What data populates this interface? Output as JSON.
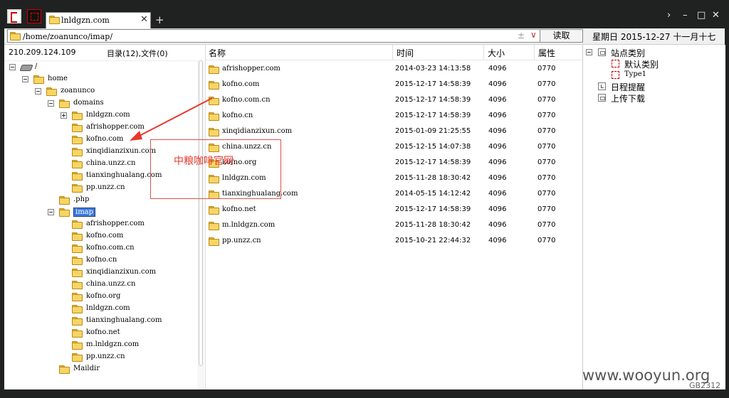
{
  "titlebar": {
    "tab_title": "lnldgzn.com",
    "tab_close": "✕",
    "tab_add": "+",
    "icons": [
      "app-logo-icon",
      "screen-record-icon",
      "folder-icon"
    ],
    "window_controls": [
      "›",
      "–",
      "□",
      "✕"
    ]
  },
  "address_bar": {
    "path": "/home/zoanunco/imap/",
    "plus": "±",
    "dropdown": "∨",
    "read_button": "读取",
    "date": "星期日  2015-12-27  十一月十七"
  },
  "left_pane": {
    "server_ip": "210.209.124.109",
    "summary": "目录(12),文件(0)",
    "tree": [
      {
        "label": "/",
        "icon": "drive-icon"
      },
      {
        "label": "home",
        "icon": "folder-icon"
      },
      {
        "label": "zoanunco",
        "icon": "folder-icon"
      },
      {
        "label": "domains",
        "icon": "folder-icon"
      },
      {
        "label": "lnldgzn.com",
        "icon": "folder-icon"
      },
      {
        "label": "afrishopper.com",
        "icon": "folder-icon"
      },
      {
        "label": "kofno.com",
        "icon": "folder-icon"
      },
      {
        "label": "xinqidianzixun.com",
        "icon": "folder-icon"
      },
      {
        "label": "china.unzz.cn",
        "icon": "folder-icon"
      },
      {
        "label": "tianxinghualang.com",
        "icon": "folder-icon"
      },
      {
        "label": "pp.unzz.cn",
        "icon": "folder-icon"
      },
      {
        "label": ".php",
        "icon": "folder-icon"
      },
      {
        "label": "imap",
        "icon": "folder-icon",
        "selected": true
      },
      {
        "label": "afrishopper.com",
        "icon": "folder-icon"
      },
      {
        "label": "kofno.com",
        "icon": "folder-icon"
      },
      {
        "label": "kofno.com.cn",
        "icon": "folder-icon"
      },
      {
        "label": "kofno.cn",
        "icon": "folder-icon"
      },
      {
        "label": "xinqidianzixun.com",
        "icon": "folder-icon"
      },
      {
        "label": "china.unzz.cn",
        "icon": "folder-icon"
      },
      {
        "label": "kofno.org",
        "icon": "folder-icon"
      },
      {
        "label": "lnldgzn.com",
        "icon": "folder-icon"
      },
      {
        "label": "tianxinghualang.com",
        "icon": "folder-icon"
      },
      {
        "label": "kofno.net",
        "icon": "folder-icon"
      },
      {
        "label": "m.lnldgzn.com",
        "icon": "folder-icon"
      },
      {
        "label": "pp.unzz.cn",
        "icon": "folder-icon"
      },
      {
        "label": "Maildir",
        "icon": "folder-icon"
      }
    ]
  },
  "file_list": {
    "columns": [
      "名称",
      "时间",
      "大小",
      "属性"
    ],
    "rows": [
      {
        "name": "afrishopper.com",
        "time": "2014-03-23 14:13:58",
        "size": "4096",
        "attr": "0770"
      },
      {
        "name": "kofno.com",
        "time": "2015-12-17 14:58:39",
        "size": "4096",
        "attr": "0770"
      },
      {
        "name": "kofno.com.cn",
        "time": "2015-12-17 14:58:39",
        "size": "4096",
        "attr": "0770"
      },
      {
        "name": "kofno.cn",
        "time": "2015-12-17 14:58:39",
        "size": "4096",
        "attr": "0770"
      },
      {
        "name": "xinqidianzixun.com",
        "time": "2015-01-09 21:25:55",
        "size": "4096",
        "attr": "0770"
      },
      {
        "name": "china.unzz.cn",
        "time": "2015-12-15 14:07:38",
        "size": "4096",
        "attr": "0770"
      },
      {
        "name": "kofno.org",
        "time": "2015-12-17 14:58:39",
        "size": "4096",
        "attr": "0770"
      },
      {
        "name": "lnldgzn.com",
        "time": "2015-11-28 18:30:42",
        "size": "4096",
        "attr": "0770"
      },
      {
        "name": "tianxinghualang.com",
        "time": "2014-05-15 14:12:42",
        "size": "4096",
        "attr": "0770"
      },
      {
        "name": "kofno.net",
        "time": "2015-12-17 14:58:39",
        "size": "4096",
        "attr": "0770"
      },
      {
        "name": "m.lnldgzn.com",
        "time": "2015-11-28 18:30:42",
        "size": "4096",
        "attr": "0770"
      },
      {
        "name": "pp.unzz.cn",
        "time": "2015-10-21 22:44:32",
        "size": "4096",
        "attr": "0770"
      }
    ]
  },
  "right_pane": {
    "items": [
      {
        "label": "站点类别"
      },
      {
        "label": "默认类别"
      },
      {
        "label": "Type1"
      },
      {
        "label": "日程提醒"
      },
      {
        "label": "上传下载"
      }
    ]
  },
  "annotation": {
    "text": "中粮咖啡官网",
    "color": "#e8372c"
  },
  "watermark": {
    "site": "www.wooyun.org",
    "bug_id": "GB2312"
  },
  "colors": {
    "frame": "#1f2220",
    "folder": "#f7d565",
    "selection": "#3d7ae0",
    "accent_red": "#e8372c"
  }
}
